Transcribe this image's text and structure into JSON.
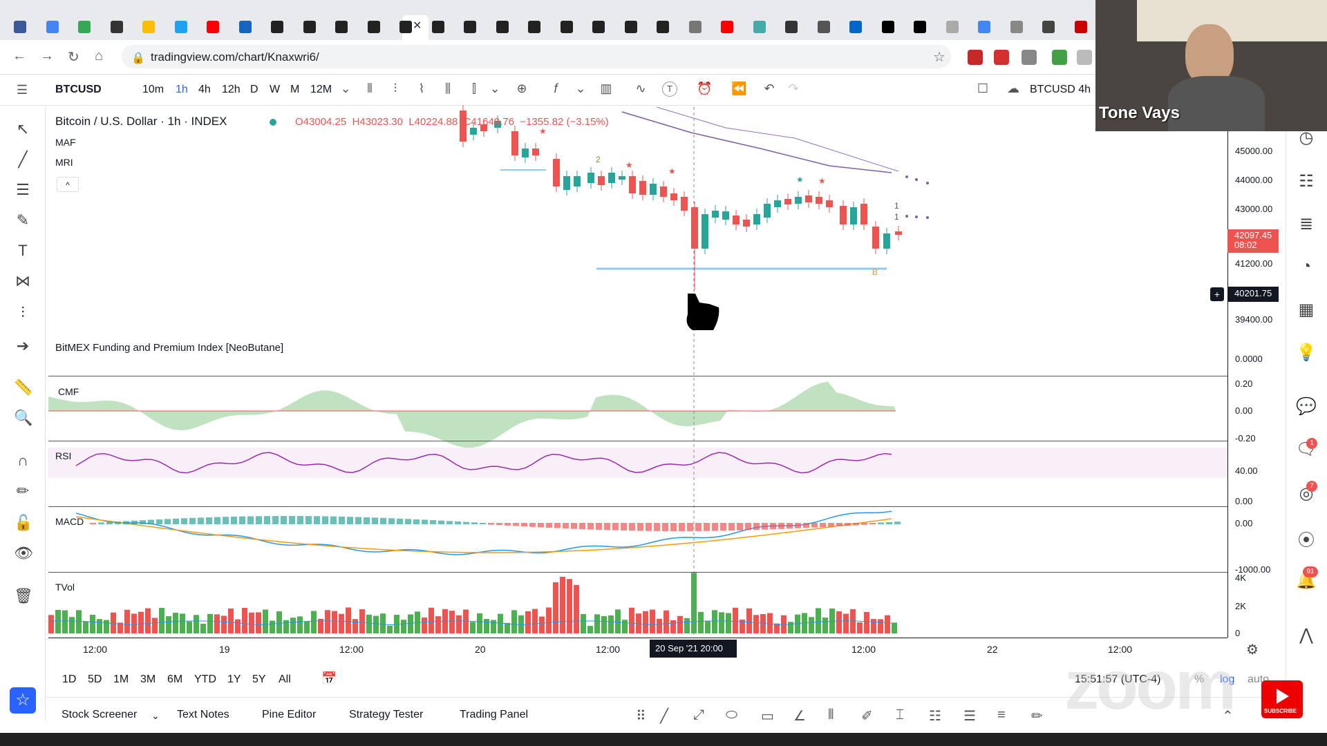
{
  "browser": {
    "url": "tradingview.com/chart/Knaxwri6/"
  },
  "toolbar": {
    "symbol": "BTCUSD",
    "intervals": [
      "10m",
      "1h",
      "4h",
      "12h",
      "D",
      "W",
      "M",
      "12M"
    ],
    "active_interval": "1h",
    "compare_symbol": "BTCUSD 4h"
  },
  "legend": {
    "title": "Bitcoin / U.S. Dollar · 1h · INDEX",
    "open": "O43004.25",
    "high": "H43023.30",
    "low": "L40224.88",
    "close": "C41649.76",
    "change": "−1355.82 (−3.15%)",
    "indicators": [
      "MAF",
      "MRI"
    ]
  },
  "panes": {
    "bitmex": "BitMEX Funding and Premium Index [NeoButane]",
    "cmf": "CMF",
    "rsi": "RSI",
    "macd": "MACD",
    "tvol": "TVol"
  },
  "price_axis": {
    "main": [
      "45000.00",
      "44000.00",
      "43000.00",
      "41200.00",
      "39400.00"
    ],
    "current_price": "42097.45",
    "countdown": "08:02",
    "crosshair_price": "40201.75",
    "bitmex": "0.0000",
    "cmf": [
      "0.20",
      "0.00",
      "-0.20"
    ],
    "rsi": [
      "40.00",
      "0.00"
    ],
    "macd": [
      "0.00",
      "-1000.00"
    ],
    "vol": [
      "4K",
      "2K",
      "0"
    ]
  },
  "time_axis": {
    "labels": [
      "12:00",
      "19",
      "12:00",
      "20",
      "12:00",
      "12:00",
      "22",
      "12:00"
    ],
    "crosshair": "20 Sep '21   20:00"
  },
  "ranges": [
    "1D",
    "5D",
    "1M",
    "3M",
    "6M",
    "YTD",
    "1Y",
    "5Y",
    "All"
  ],
  "status": {
    "time": "15:51:57 (UTC-4)",
    "percent": "%",
    "log": "log",
    "auto": "auto"
  },
  "bottom_tabs": [
    "Stock Screener",
    "Text Notes",
    "Pine Editor",
    "Strategy Tester",
    "Trading Panel"
  ],
  "webcam": {
    "name": "Tone Vays"
  },
  "watermark": "zoom",
  "subscribe": "SUBSCRIBE",
  "badges": {
    "chat": "1",
    "ideas": "7",
    "alerts": "91"
  },
  "markers": {
    "a": "2",
    "b": "1",
    "c": "1",
    "d": "B"
  },
  "colors": {
    "up": "#26a69a",
    "down": "#ef5350",
    "accent": "#2962ff"
  }
}
